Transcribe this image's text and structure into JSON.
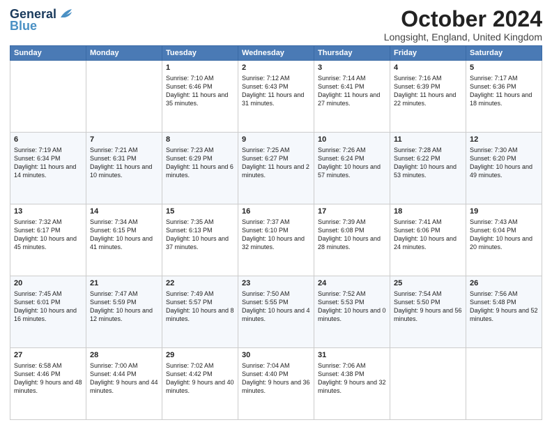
{
  "logo": {
    "line1": "General",
    "line2": "Blue"
  },
  "title": "October 2024",
  "location": "Longsight, England, United Kingdom",
  "days_of_week": [
    "Sunday",
    "Monday",
    "Tuesday",
    "Wednesday",
    "Thursday",
    "Friday",
    "Saturday"
  ],
  "weeks": [
    [
      {
        "day": "",
        "sunrise": "",
        "sunset": "",
        "daylight": ""
      },
      {
        "day": "",
        "sunrise": "",
        "sunset": "",
        "daylight": ""
      },
      {
        "day": "1",
        "sunrise": "Sunrise: 7:10 AM",
        "sunset": "Sunset: 6:46 PM",
        "daylight": "Daylight: 11 hours and 35 minutes."
      },
      {
        "day": "2",
        "sunrise": "Sunrise: 7:12 AM",
        "sunset": "Sunset: 6:43 PM",
        "daylight": "Daylight: 11 hours and 31 minutes."
      },
      {
        "day": "3",
        "sunrise": "Sunrise: 7:14 AM",
        "sunset": "Sunset: 6:41 PM",
        "daylight": "Daylight: 11 hours and 27 minutes."
      },
      {
        "day": "4",
        "sunrise": "Sunrise: 7:16 AM",
        "sunset": "Sunset: 6:39 PM",
        "daylight": "Daylight: 11 hours and 22 minutes."
      },
      {
        "day": "5",
        "sunrise": "Sunrise: 7:17 AM",
        "sunset": "Sunset: 6:36 PM",
        "daylight": "Daylight: 11 hours and 18 minutes."
      }
    ],
    [
      {
        "day": "6",
        "sunrise": "Sunrise: 7:19 AM",
        "sunset": "Sunset: 6:34 PM",
        "daylight": "Daylight: 11 hours and 14 minutes."
      },
      {
        "day": "7",
        "sunrise": "Sunrise: 7:21 AM",
        "sunset": "Sunset: 6:31 PM",
        "daylight": "Daylight: 11 hours and 10 minutes."
      },
      {
        "day": "8",
        "sunrise": "Sunrise: 7:23 AM",
        "sunset": "Sunset: 6:29 PM",
        "daylight": "Daylight: 11 hours and 6 minutes."
      },
      {
        "day": "9",
        "sunrise": "Sunrise: 7:25 AM",
        "sunset": "Sunset: 6:27 PM",
        "daylight": "Daylight: 11 hours and 2 minutes."
      },
      {
        "day": "10",
        "sunrise": "Sunrise: 7:26 AM",
        "sunset": "Sunset: 6:24 PM",
        "daylight": "Daylight: 10 hours and 57 minutes."
      },
      {
        "day": "11",
        "sunrise": "Sunrise: 7:28 AM",
        "sunset": "Sunset: 6:22 PM",
        "daylight": "Daylight: 10 hours and 53 minutes."
      },
      {
        "day": "12",
        "sunrise": "Sunrise: 7:30 AM",
        "sunset": "Sunset: 6:20 PM",
        "daylight": "Daylight: 10 hours and 49 minutes."
      }
    ],
    [
      {
        "day": "13",
        "sunrise": "Sunrise: 7:32 AM",
        "sunset": "Sunset: 6:17 PM",
        "daylight": "Daylight: 10 hours and 45 minutes."
      },
      {
        "day": "14",
        "sunrise": "Sunrise: 7:34 AM",
        "sunset": "Sunset: 6:15 PM",
        "daylight": "Daylight: 10 hours and 41 minutes."
      },
      {
        "day": "15",
        "sunrise": "Sunrise: 7:35 AM",
        "sunset": "Sunset: 6:13 PM",
        "daylight": "Daylight: 10 hours and 37 minutes."
      },
      {
        "day": "16",
        "sunrise": "Sunrise: 7:37 AM",
        "sunset": "Sunset: 6:10 PM",
        "daylight": "Daylight: 10 hours and 32 minutes."
      },
      {
        "day": "17",
        "sunrise": "Sunrise: 7:39 AM",
        "sunset": "Sunset: 6:08 PM",
        "daylight": "Daylight: 10 hours and 28 minutes."
      },
      {
        "day": "18",
        "sunrise": "Sunrise: 7:41 AM",
        "sunset": "Sunset: 6:06 PM",
        "daylight": "Daylight: 10 hours and 24 minutes."
      },
      {
        "day": "19",
        "sunrise": "Sunrise: 7:43 AM",
        "sunset": "Sunset: 6:04 PM",
        "daylight": "Daylight: 10 hours and 20 minutes."
      }
    ],
    [
      {
        "day": "20",
        "sunrise": "Sunrise: 7:45 AM",
        "sunset": "Sunset: 6:01 PM",
        "daylight": "Daylight: 10 hours and 16 minutes."
      },
      {
        "day": "21",
        "sunrise": "Sunrise: 7:47 AM",
        "sunset": "Sunset: 5:59 PM",
        "daylight": "Daylight: 10 hours and 12 minutes."
      },
      {
        "day": "22",
        "sunrise": "Sunrise: 7:49 AM",
        "sunset": "Sunset: 5:57 PM",
        "daylight": "Daylight: 10 hours and 8 minutes."
      },
      {
        "day": "23",
        "sunrise": "Sunrise: 7:50 AM",
        "sunset": "Sunset: 5:55 PM",
        "daylight": "Daylight: 10 hours and 4 minutes."
      },
      {
        "day": "24",
        "sunrise": "Sunrise: 7:52 AM",
        "sunset": "Sunset: 5:53 PM",
        "daylight": "Daylight: 10 hours and 0 minutes."
      },
      {
        "day": "25",
        "sunrise": "Sunrise: 7:54 AM",
        "sunset": "Sunset: 5:50 PM",
        "daylight": "Daylight: 9 hours and 56 minutes."
      },
      {
        "day": "26",
        "sunrise": "Sunrise: 7:56 AM",
        "sunset": "Sunset: 5:48 PM",
        "daylight": "Daylight: 9 hours and 52 minutes."
      }
    ],
    [
      {
        "day": "27",
        "sunrise": "Sunrise: 6:58 AM",
        "sunset": "Sunset: 4:46 PM",
        "daylight": "Daylight: 9 hours and 48 minutes."
      },
      {
        "day": "28",
        "sunrise": "Sunrise: 7:00 AM",
        "sunset": "Sunset: 4:44 PM",
        "daylight": "Daylight: 9 hours and 44 minutes."
      },
      {
        "day": "29",
        "sunrise": "Sunrise: 7:02 AM",
        "sunset": "Sunset: 4:42 PM",
        "daylight": "Daylight: 9 hours and 40 minutes."
      },
      {
        "day": "30",
        "sunrise": "Sunrise: 7:04 AM",
        "sunset": "Sunset: 4:40 PM",
        "daylight": "Daylight: 9 hours and 36 minutes."
      },
      {
        "day": "31",
        "sunrise": "Sunrise: 7:06 AM",
        "sunset": "Sunset: 4:38 PM",
        "daylight": "Daylight: 9 hours and 32 minutes."
      },
      {
        "day": "",
        "sunrise": "",
        "sunset": "",
        "daylight": ""
      },
      {
        "day": "",
        "sunrise": "",
        "sunset": "",
        "daylight": ""
      }
    ]
  ]
}
